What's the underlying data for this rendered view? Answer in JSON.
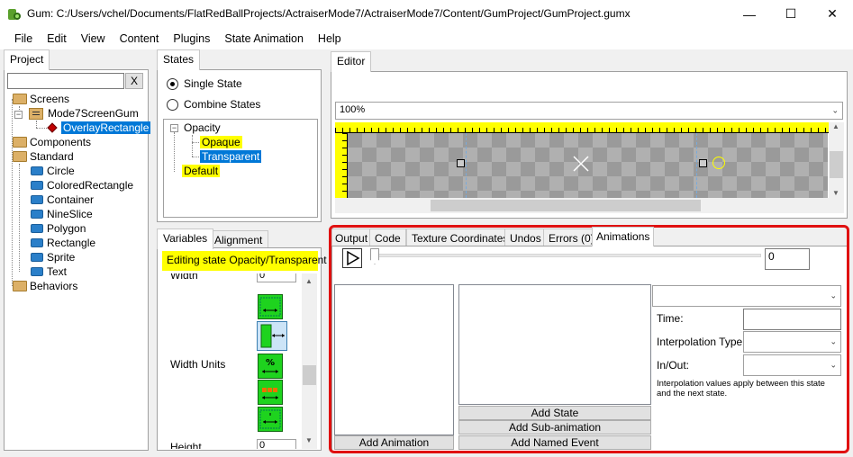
{
  "window": {
    "title": "Gum: C:/Users/vchel/Documents/FlatRedBallProjects/ActraiserMode7/ActraiserMode7/Content/GumProject/GumProject.gumx",
    "minimize": "—",
    "maximize": "☐",
    "close": "✕"
  },
  "menu": [
    "File",
    "Edit",
    "View",
    "Content",
    "Plugins",
    "State Animation",
    "Help"
  ],
  "project": {
    "tab": "Project",
    "search_value": "",
    "clear_label": "X",
    "tree": {
      "screens": "Screens",
      "screen_item": "Mode7ScreenGum",
      "screen_child": "OverlayRectangle",
      "components": "Components",
      "standard": "Standard",
      "standard_items": [
        "Circle",
        "ColoredRectangle",
        "Container",
        "NineSlice",
        "Polygon",
        "Rectangle",
        "Sprite",
        "Text"
      ],
      "behaviors": "Behaviors"
    }
  },
  "states": {
    "tab": "States",
    "single": "Single State",
    "combine": "Combine States",
    "category": "Opacity",
    "items": [
      "Opaque",
      "Transparent"
    ],
    "default": "Default"
  },
  "variables": {
    "tab_variables": "Variables",
    "tab_alignment": "Alignment",
    "editing_banner": "Editing state Opacity/Transparent",
    "width_label": "Width",
    "width_value": "0",
    "width_units_label": "Width Units",
    "height_label": "Height",
    "height_value": "0"
  },
  "editor": {
    "tab": "Editor",
    "zoom": "100%"
  },
  "bottom_tabs": [
    "Output",
    "Code",
    "Texture Coordinates",
    "Undos",
    "Errors (0)",
    "Animations"
  ],
  "animations": {
    "frame_value": "0",
    "add_animation": "Add Animation",
    "add_state": "Add State",
    "add_sub_animation": "Add Sub-animation",
    "add_named_event": "Add Named Event",
    "time_label": "Time:",
    "interp_type_label": "Interpolation Type:",
    "in_out_label": "In/Out:",
    "note": "Interpolation values apply between this state and the next state."
  },
  "colors": {
    "selection": "#0078d7",
    "highlight": "#ffff00",
    "ruler": "#ffff00",
    "annotation_border": "#e01010"
  }
}
